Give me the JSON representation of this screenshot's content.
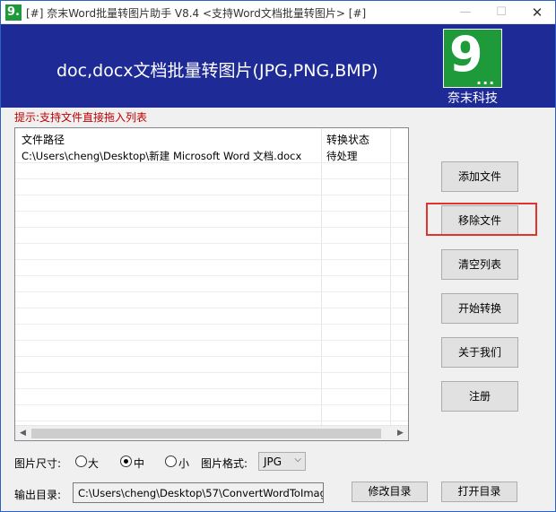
{
  "window": {
    "title": "[#] 奈末Word批量转图片助手 V8.4    <支持Word文档批量转图片> [#]",
    "app_icon_glyph": "9.",
    "minimize_glyph": "—",
    "maximize_glyph": "☐",
    "close_glyph": "✕"
  },
  "banner": {
    "title": "doc,docx文档批量转图片(JPG,PNG,BMP)",
    "logo_glyph": "9",
    "logo_dots": "...",
    "logo_caption": "奈末科技",
    "background_color": "#1e2b97",
    "logo_color": "#1e9a3b"
  },
  "hint": "提示:支持文件直接拖入列表",
  "file_list": {
    "columns": [
      "文件路径",
      "转换状态"
    ],
    "rows": [
      {
        "path": "C:\\Users\\cheng\\Desktop\\新建 Microsoft Word 文档.docx",
        "status": "待处理"
      }
    ]
  },
  "actions": {
    "add_file": "添加文件",
    "remove_file": "移除文件",
    "clear_list": "清空列表",
    "start_convert": "开始转换",
    "about_us": "关于我们",
    "register": "注册"
  },
  "options": {
    "size_label": "图片尺寸:",
    "size_large": "大",
    "size_medium": "中",
    "size_small": "小",
    "selected_size": "中",
    "format_label": "图片格式:",
    "format_value": "JPG",
    "output_label": "输出目录:",
    "output_path": "C:\\Users\\cheng\\Desktop\\57\\ConvertWordToImag",
    "change_dir": "修改目录",
    "open_dir": "打开目录"
  },
  "highlight_color": "#e0342c"
}
